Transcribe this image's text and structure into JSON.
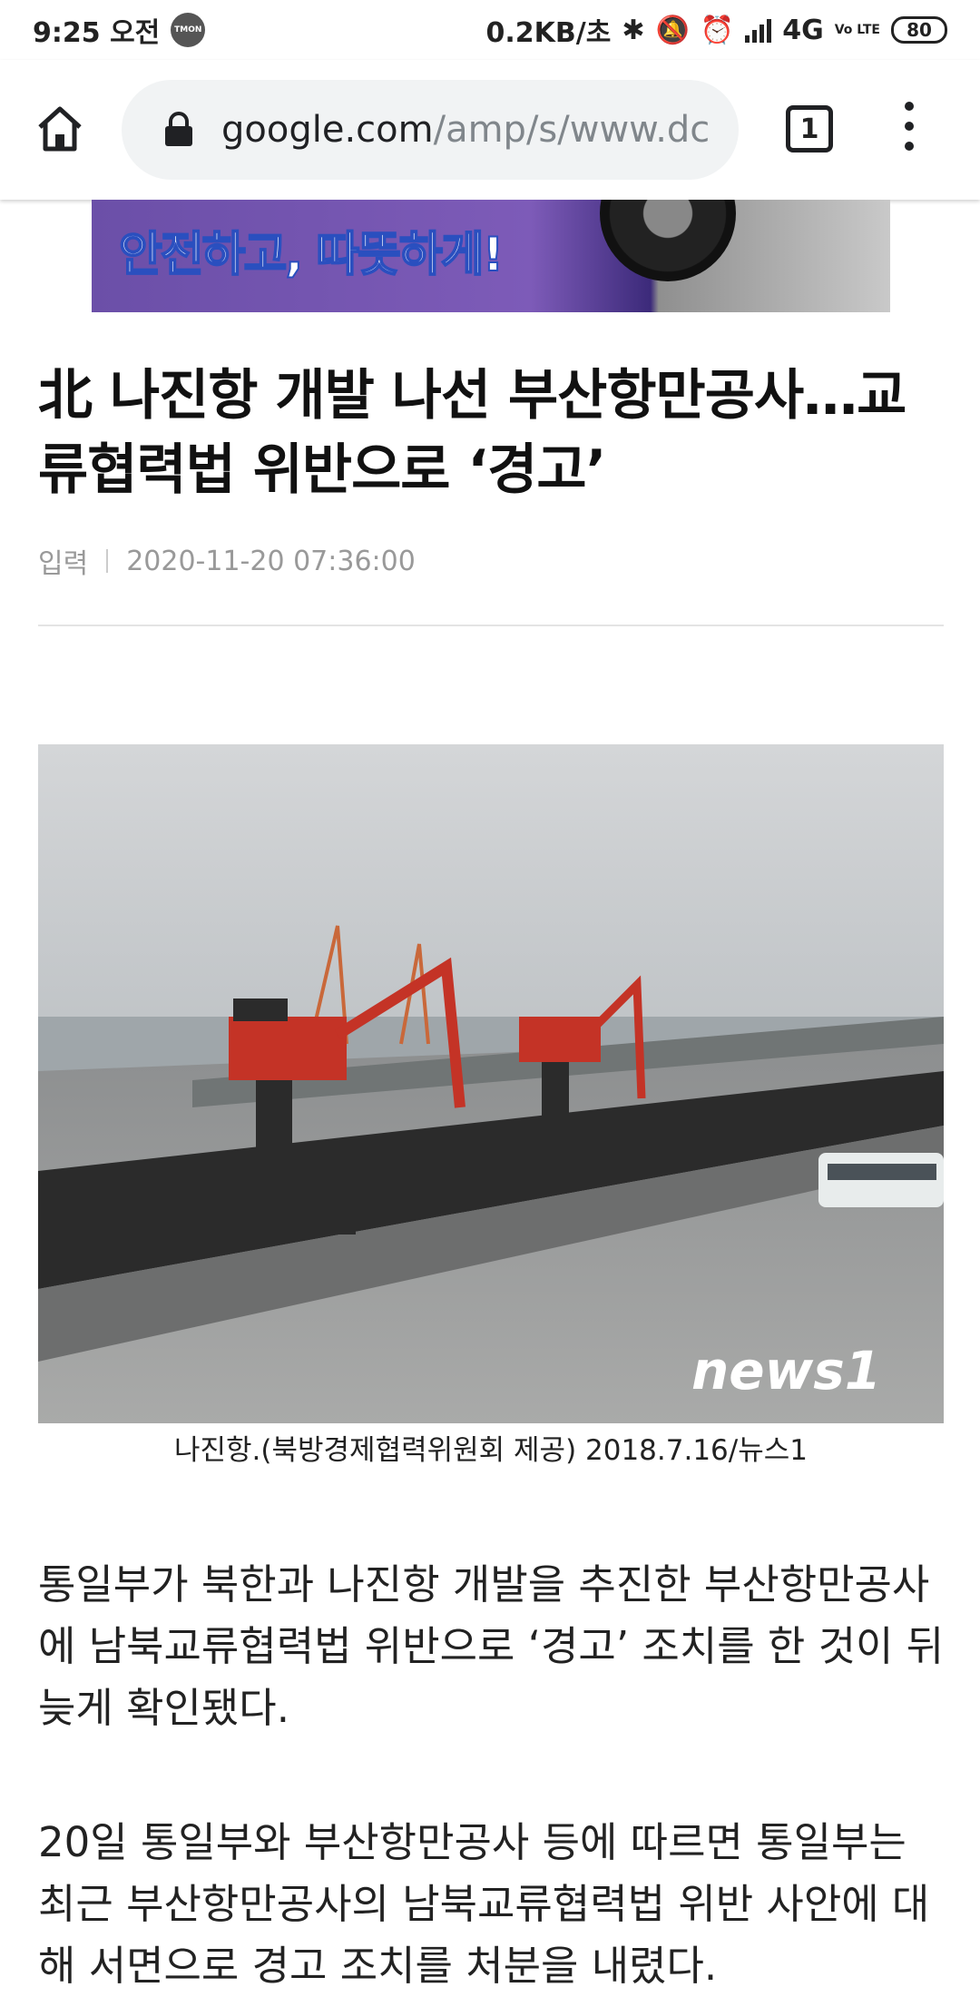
{
  "status_bar": {
    "time": "9:25 오전",
    "notif_icon_label": "TMON",
    "net_speed": "0.2KB/초",
    "network": "4G",
    "volte_label": "Vo LTE",
    "battery": "80"
  },
  "browser": {
    "url_host": "google.com",
    "url_path": "/amp/s/www.dc",
    "tab_count": "1"
  },
  "ad": {
    "headline": "안전하고, 따뜻하게!"
  },
  "article": {
    "title": "北 나진항 개발 나선 부산항만공사…교류협력법 위반으로 ‘경고’",
    "meta_label": "입력",
    "date": "2020-11-20 07:36:00",
    "image_watermark": "news1",
    "caption": "나진항.(북방경제협력위원회 제공) 2018.7.16/뉴스1",
    "paragraphs": [
      "통일부가 북한과 나진항 개발을 추진한 부산항만공사에 남북교류협력법 위반으로 ‘경고’ 조치를 한 것이 뒤늦게 확인됐다.",
      "20일 통일부와 부산항만공사 등에 따르면 통일부는 최근 부산항만공사의 남북교류협력법 위반 사안에 대해 서면으로 경고 조치를 처분을 내렸다."
    ]
  }
}
